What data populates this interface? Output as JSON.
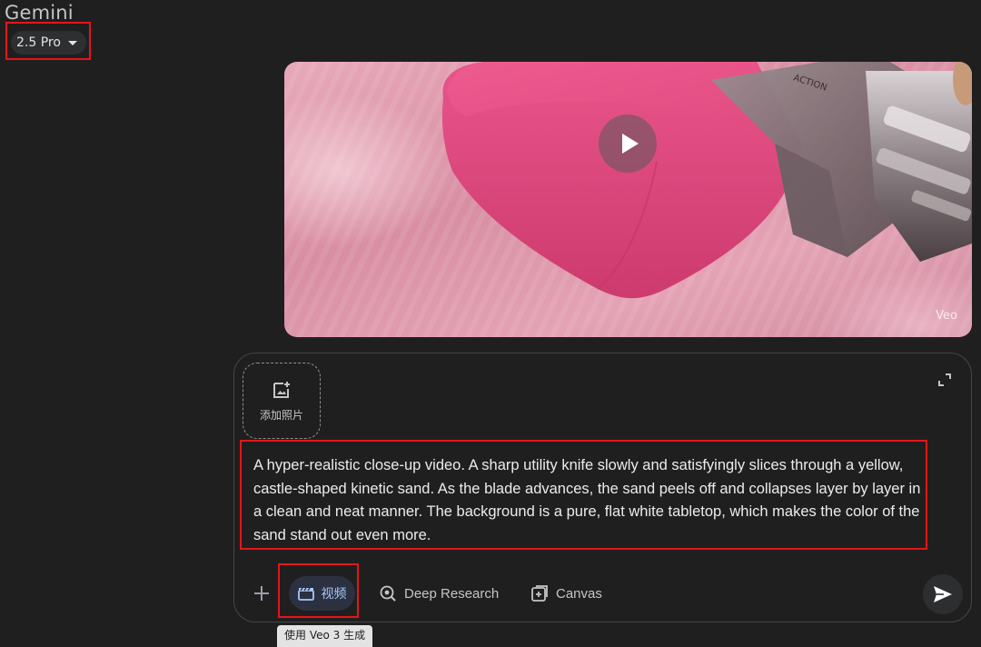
{
  "app": {
    "title": "Gemini"
  },
  "model_selector": {
    "label": "2.5 Pro",
    "icon": "caret-down-icon"
  },
  "video": {
    "watermark": "Veo",
    "play_icon": "play-icon"
  },
  "composer": {
    "add_photo_label": "添加照片",
    "add_photo_icon": "add-image-icon",
    "expand_icon": "expand-icon",
    "prompt_text": "A hyper-realistic close-up video. A sharp utility knife slowly and satisfyingly slices through a yellow, castle-shaped kinetic sand. As the blade advances, the sand peels off and collapses layer by layer in a clean and neat manner. The background is a pure, flat white tabletop, which makes the color of the sand stand out even more."
  },
  "toolbar": {
    "plus_icon": "plus-icon",
    "video_label": "视频",
    "video_icon": "clapperboard-icon",
    "deep_research_label": "Deep Research",
    "deep_research_icon": "deep-research-icon",
    "canvas_label": "Canvas",
    "canvas_icon": "canvas-icon",
    "send_icon": "send-icon"
  },
  "tooltip": {
    "text": "使用 Veo 3 生成"
  },
  "colors": {
    "background": "#1f1f1f",
    "annotation": "#e8141a",
    "active_tool_text": "#a8c7fa",
    "active_tool_bg": "#2b3141"
  }
}
